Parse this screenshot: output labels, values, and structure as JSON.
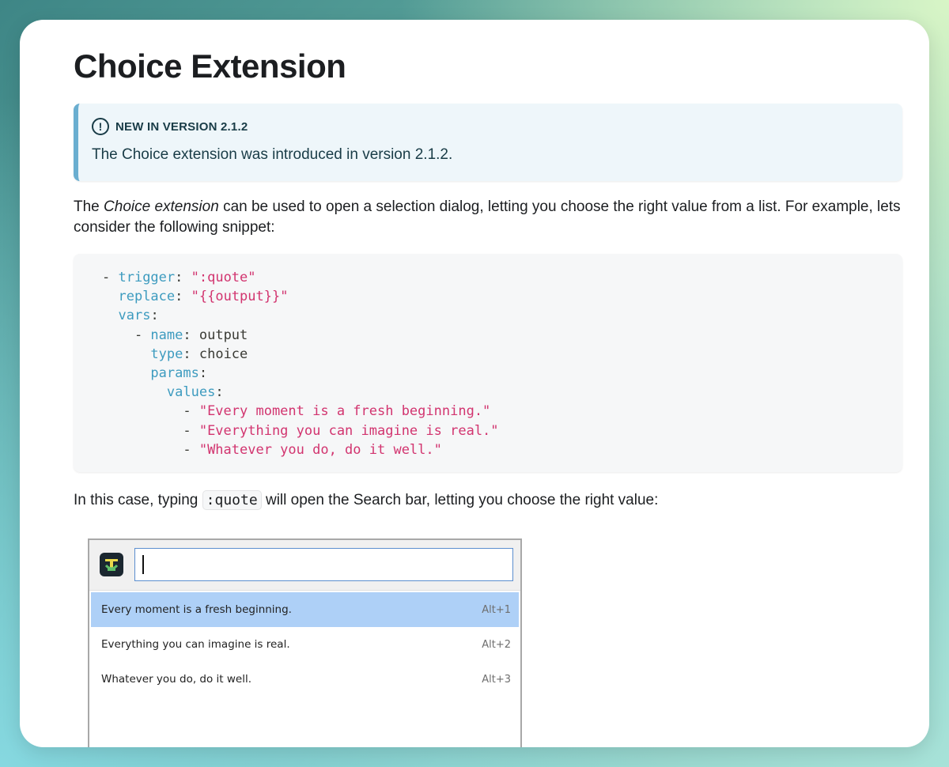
{
  "page": {
    "title": "Choice Extension"
  },
  "admonition": {
    "heading": "NEW IN VERSION 2.1.2",
    "icon": "exclamation-circle-icon",
    "body": "The Choice extension was introduced in version 2.1.2."
  },
  "intro": {
    "before_em": "The ",
    "em": "Choice extension",
    "after_em": " can be used to open a selection dialog, letting you choose the right value from a list. For example, lets consider the following snippet:"
  },
  "code": {
    "lines": [
      {
        "indent": "- ",
        "key": "trigger",
        "sep": ": ",
        "value": "\":quote\"",
        "value_type": "string"
      },
      {
        "indent": "  ",
        "key": "replace",
        "sep": ": ",
        "value": "\"{{output}}\"",
        "value_type": "string"
      },
      {
        "indent": "  ",
        "key": "vars",
        "sep": ":",
        "value": "",
        "value_type": "none"
      },
      {
        "indent": "    - ",
        "key": "name",
        "sep": ": ",
        "value": "output",
        "value_type": "plain"
      },
      {
        "indent": "      ",
        "key": "type",
        "sep": ": ",
        "value": "choice",
        "value_type": "plain"
      },
      {
        "indent": "      ",
        "key": "params",
        "sep": ":",
        "value": "",
        "value_type": "none"
      },
      {
        "indent": "        ",
        "key": "values",
        "sep": ":",
        "value": "",
        "value_type": "none"
      },
      {
        "indent": "          - ",
        "key": "",
        "sep": "",
        "value": "\"Every moment is a fresh beginning.\"",
        "value_type": "string"
      },
      {
        "indent": "          - ",
        "key": "",
        "sep": "",
        "value": "\"Everything you can imagine is real.\"",
        "value_type": "string"
      },
      {
        "indent": "          - ",
        "key": "",
        "sep": "",
        "value": "\"Whatever you do, do it well.\"",
        "value_type": "string"
      }
    ]
  },
  "typing": {
    "before": "In this case, typing ",
    "code": ":quote",
    "after": " will open the Search bar, letting you choose the right value:"
  },
  "searchbar": {
    "logo_icon": "espanso-logo-icon",
    "input_value": "",
    "items": [
      {
        "label": "Every moment is a fresh beginning.",
        "shortcut": "Alt+1",
        "selected": true
      },
      {
        "label": "Everything you can imagine is real.",
        "shortcut": "Alt+2",
        "selected": false
      },
      {
        "label": "Whatever you do, do it well.",
        "shortcut": "Alt+3",
        "selected": false
      }
    ]
  },
  "colors": {
    "code_key": "#3d9bbf",
    "code_string": "#d2346f",
    "admonition_border": "#6aaed0",
    "selected_item": "#aed0f7"
  }
}
